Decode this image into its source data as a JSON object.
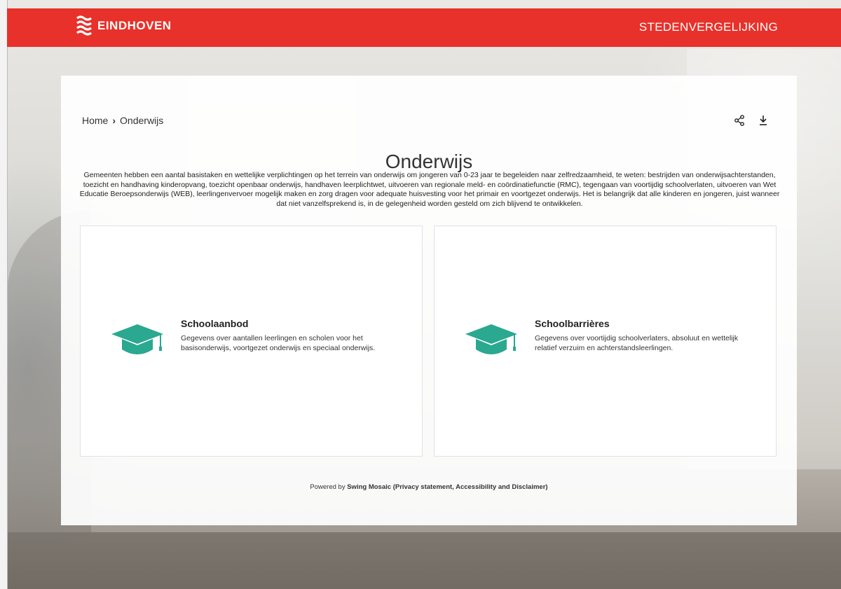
{
  "header": {
    "logo_text": "EINDHOVEN",
    "nav_label": "STEDENVERGELIJKING"
  },
  "breadcrumb": {
    "home": "Home",
    "current": "Onderwijs"
  },
  "page": {
    "title": "Onderwijs",
    "intro": "Gemeenten hebben een aantal basistaken en wettelijke verplichtingen op het terrein van onderwijs om jongeren van 0-23 jaar te begeleiden naar zelfredzaamheid, te weten: bestrijden van onderwijsachterstanden, toezicht en handhaving kinderopvang, toezicht openbaar onderwijs, handhaven leerplichtwet, uitvoeren van regionale meld- en coördinatiefunctie (RMC), tegengaan van voortijdig schoolverlaten, uitvoeren van Wet Educatie Beroepsonderwijs (WEB), leerlingenvervoer mogelijk maken en zorg dragen voor adequate huisvesting voor het primair en voortgezet onderwijs. Het is belangrijk dat alle kinderen en jongeren, juist wanneer dat niet vanzelfsprekend is, in de gelegenheid worden gesteld om zich blijvend te ontwikkelen."
  },
  "cards": [
    {
      "title": "Schoolaanbod",
      "description": "Gegevens over aantallen leerlingen en scholen voor het basisonderwijs, voortgezet onderwijs en speciaal onderwijs.",
      "icon": "graduation-cap-icon"
    },
    {
      "title": "Schoolbarrières",
      "description": "Gegevens over voortijdig schoolverlaters, absoluut en wettelijk relatief verzuim en achterstandsleerlingen.",
      "icon": "graduation-cap-icon"
    }
  ],
  "footer": {
    "prefix": "Powered by ",
    "brand": "Swing Mosaic",
    "links": "(Privacy statement, Accessibility and Disclaimer)"
  },
  "colors": {
    "header_red": "#e8312a",
    "icon_teal": "#2aa890"
  }
}
